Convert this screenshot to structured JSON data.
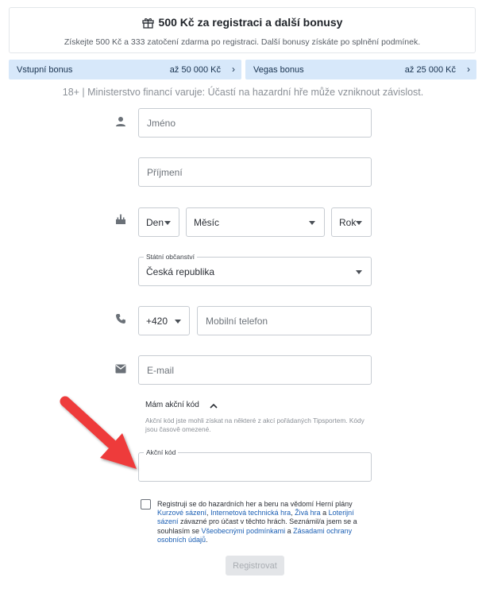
{
  "promo": {
    "title": "500 Kč za registraci a další bonusy",
    "subtitle": "Získejte 500 Kč a 333 zatočení zdarma po registraci. Další bonusy získáte po splnění podmínek.",
    "icon": "gift-icon"
  },
  "bonuses": [
    {
      "label": "Vstupní bonus",
      "amount": "až 50 000 Kč"
    },
    {
      "label": "Vegas bonus",
      "amount": "až 25 000 Kč"
    }
  ],
  "warning": "18+ | Ministerstvo financí varuje: Účastí na hazardní hře může vzniknout závislost.",
  "form": {
    "first_name_placeholder": "Jméno",
    "last_name_placeholder": "Příjmení",
    "day": "Den",
    "month": "Měsíc",
    "year": "Rok",
    "citizenship_label": "Státní občanství",
    "citizenship_value": "Česká republika",
    "phone_prefix": "+420",
    "phone_placeholder": "Mobilní telefon",
    "email_placeholder": "E-mail",
    "code_toggle": "Mám akční kód",
    "code_note": "Akční kód jste mohli získat na některé z akcí pořádaných Tipsportem. Kódy jsou časově omezené.",
    "code_label": "Akční kód",
    "code_value": ""
  },
  "consent": {
    "t1": "Registruji se do hazardních her a beru na vědomí Herní plány ",
    "l1": "Kurzové sázení",
    "t2": ", ",
    "l2": "Internetová technická hra",
    "t3": ", ",
    "l3": "Živá hra",
    "t4": " a ",
    "l4": "Loterijní sázení",
    "t5": " závazné pro účast v těchto hrách. Seznámil/a jsem se a souhlasím se ",
    "l5": "Všeobecnými podmínkami",
    "t6": " a ",
    "l6": "Zásadami ochrany osobních údajů",
    "t7": "."
  },
  "submit_label": "Registrovat",
  "colors": {
    "bonus_bg": "#d7e8fa",
    "link": "#1b5fb4",
    "arrow": "#ee3b3b",
    "disabled_button": "#e3e5e8"
  },
  "icons": [
    "person-icon",
    "birthday-cake-icon",
    "phone-icon",
    "mail-icon",
    "chevron-right-icon",
    "caret-down-icon",
    "chevron-up-icon"
  ]
}
